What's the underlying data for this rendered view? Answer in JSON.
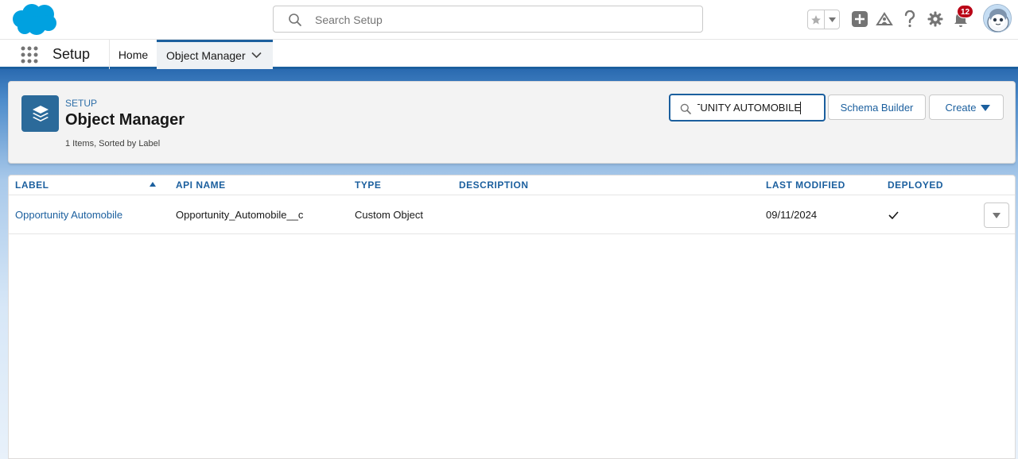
{
  "global_header": {
    "search_placeholder": "Search Setup",
    "notification_count": "12"
  },
  "context_bar": {
    "app_name": "Setup",
    "tabs": [
      {
        "label": "Home"
      },
      {
        "label": "Object Manager"
      }
    ]
  },
  "page_header": {
    "breadcrumb": "SETUP",
    "title": "Object Manager",
    "meta": "1 Items, Sorted by Label",
    "quick_find_value": "RTUNITY AUTOMOBILE",
    "schema_builder_label": "Schema Builder",
    "create_label": "Create"
  },
  "table": {
    "columns": [
      "LABEL",
      "API NAME",
      "TYPE",
      "DESCRIPTION",
      "LAST MODIFIED",
      "DEPLOYED"
    ],
    "rows": [
      {
        "label": "Opportunity Automobile",
        "api_name": "Opportunity_Automobile__c",
        "type": "Custom Object",
        "description": "",
        "last_modified": "09/11/2024",
        "deployed": true
      }
    ]
  },
  "colors": {
    "brand": "#1b5f9e",
    "salesforce_cloud": "#00a1e0",
    "badge": "#ba0517"
  },
  "icons": [
    "salesforce-logo",
    "search-icon",
    "star-icon",
    "plus-icon",
    "trailhead-icon",
    "help-icon",
    "gear-icon",
    "bell-icon",
    "app-launcher-icon",
    "layers-icon",
    "check-icon",
    "chevron-down-icon"
  ]
}
